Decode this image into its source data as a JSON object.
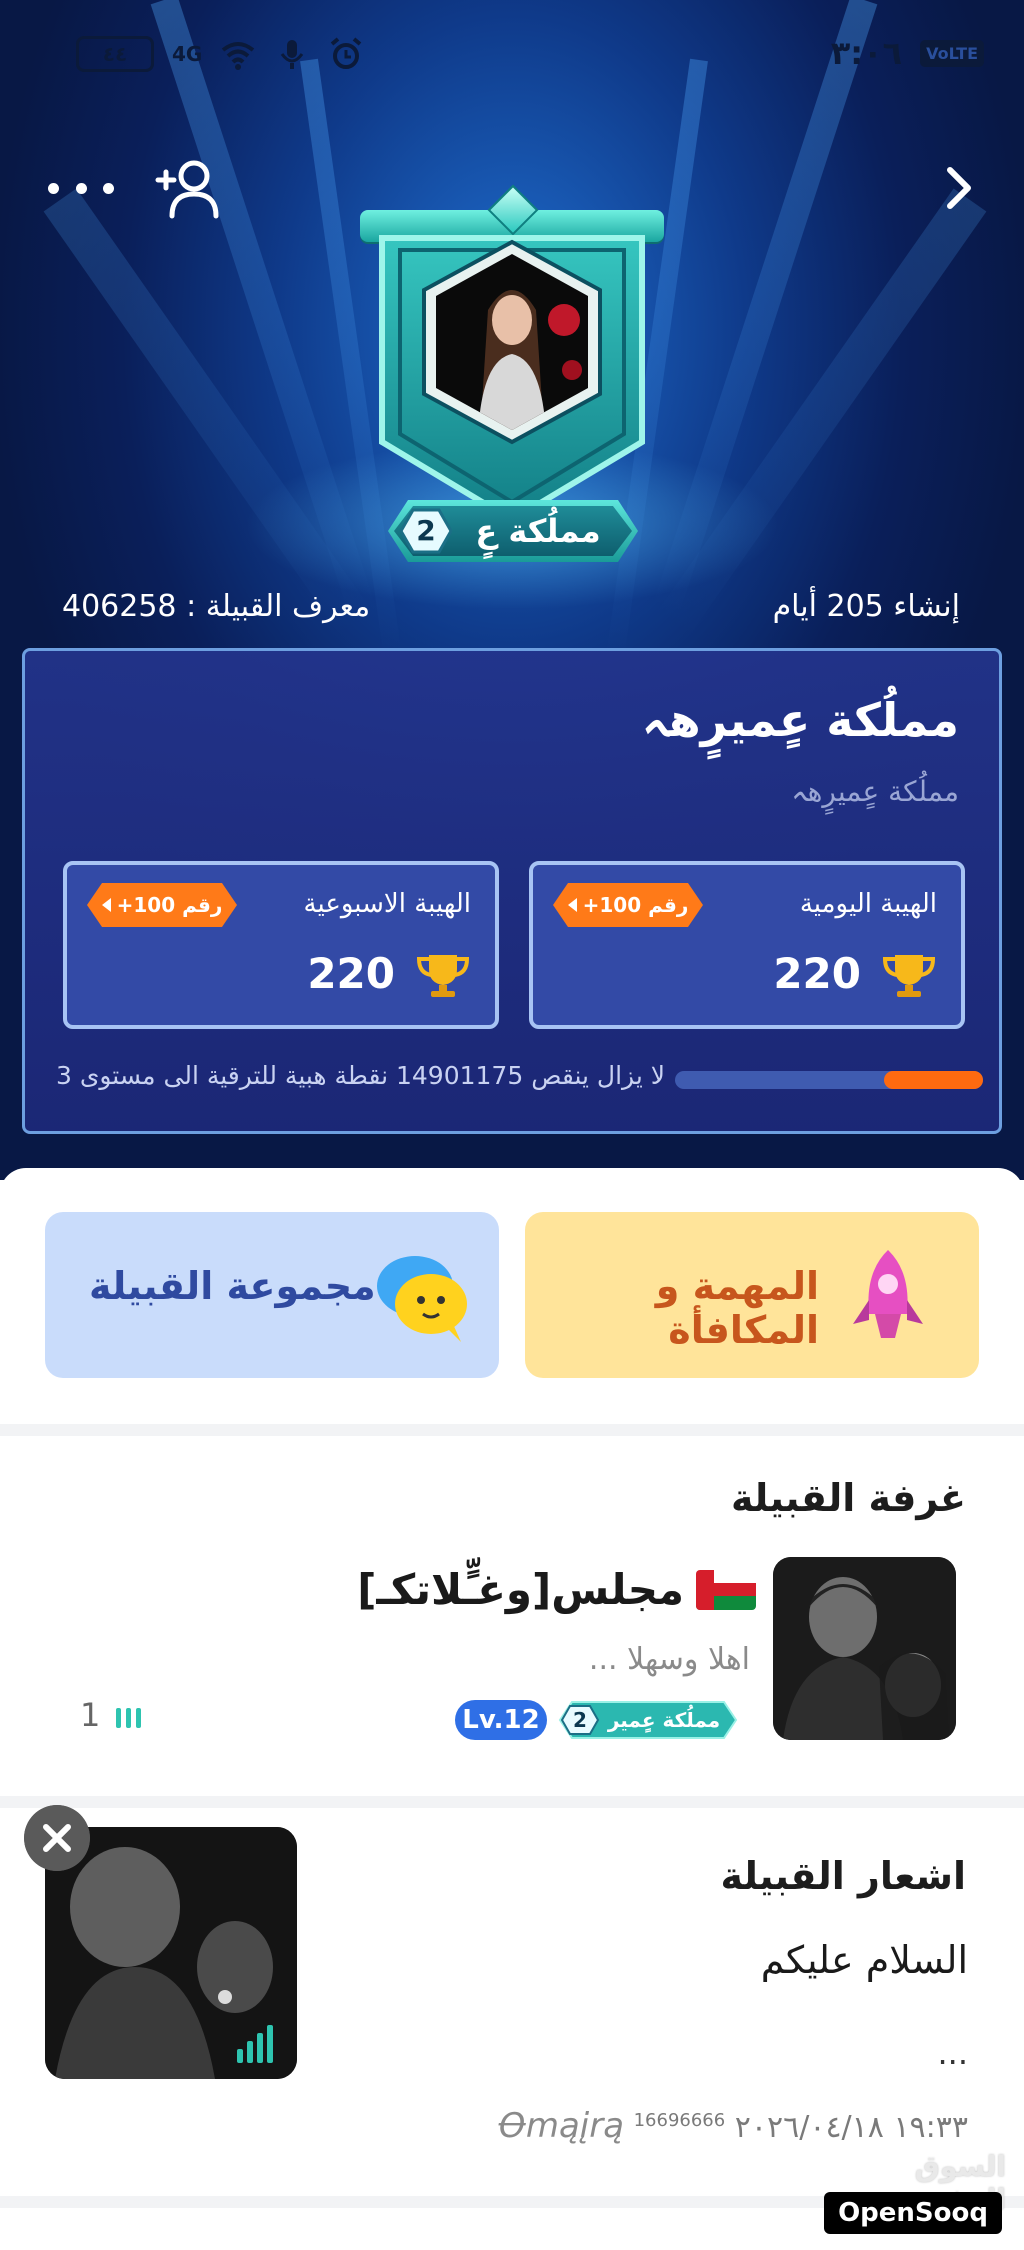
{
  "statusbar": {
    "battery": "٤٤",
    "network": "4G",
    "time": "٣:٠٦",
    "volte": "VoLTE"
  },
  "icons": {
    "more": "more-dots-icon",
    "add_member": "add-user-icon",
    "back": "chevron-right-icon"
  },
  "tribe": {
    "level": "2",
    "badge_name": "مملُكة عٍ",
    "created": "إنشاء 205 أيام",
    "id_label": "معرف القبيلة  :  406258",
    "name": "مملُكة عٍميرٍهہ",
    "subtitle": "مملُكة عٍميرٍهہ"
  },
  "stats": {
    "daily": {
      "label": "الهيبة اليومية",
      "rank": "رقم 100+",
      "value": "220"
    },
    "weekly": {
      "label": "الهيبة الاسبوعية",
      "rank": "رقم 100+",
      "value": "220"
    }
  },
  "progress": {
    "fraction": 0.32,
    "text": "لا يزال ينقص 14901175 نقطة هبية للترقية الى مستوى 3",
    "fill_color": "#ff6a10"
  },
  "quick_actions": {
    "task": "المهمة و المكافأة",
    "group": "مجموعة القبيلة"
  },
  "room": {
    "section_title": "غرفة القبيلة",
    "name": "مجلس[وغـٍّلاتکـ]",
    "desc": "اهلا وسهلا ...",
    "tag_level": "2",
    "tag_name": "مملُكة عٍمير",
    "lv": "Lv.12",
    "count": "1"
  },
  "post": {
    "section_title": "اشعار القبيلة",
    "text": "السلام عليكم",
    "more": "...",
    "datetime": "١٩:٣٣ ٢٠٢٦/٠٤/١٨",
    "uid": "16696666",
    "user": "Ꝋmąįrą"
  },
  "watermark": {
    "arabic": "السوق المفتوح",
    "brand": "OpenSooq"
  }
}
